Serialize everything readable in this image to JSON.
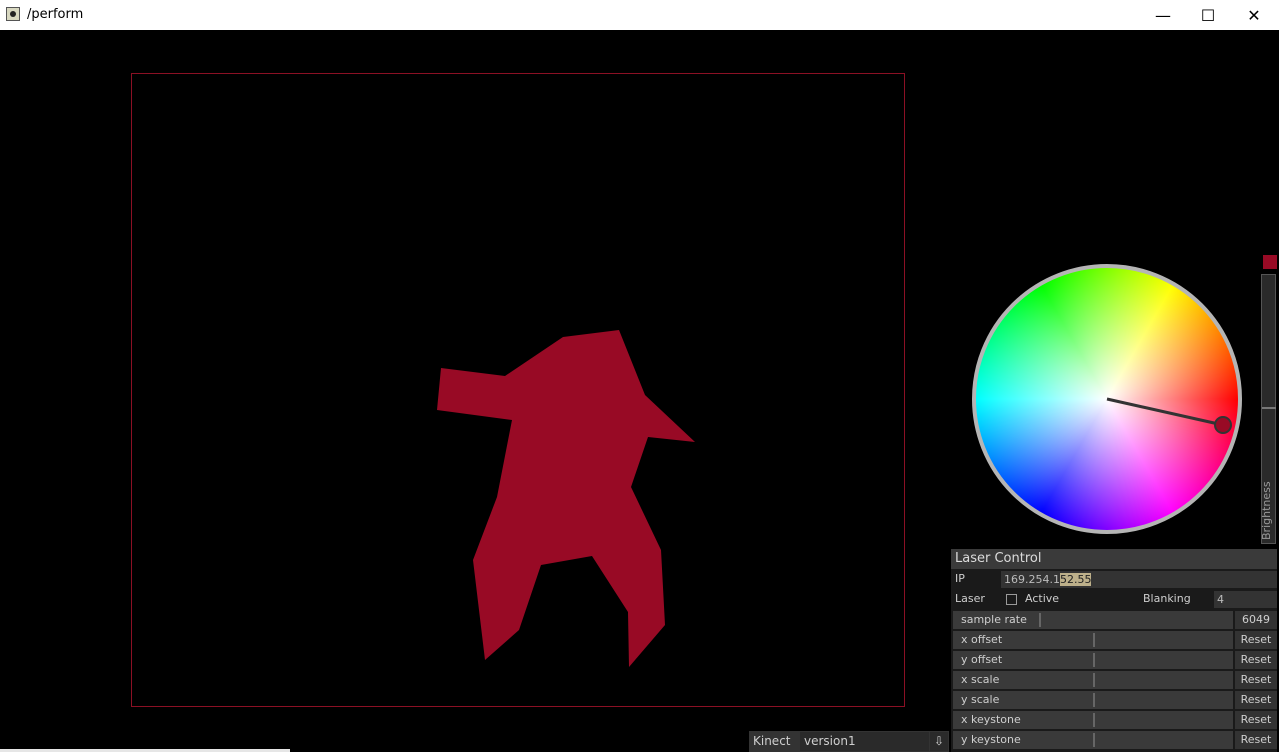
{
  "window": {
    "title": "/perform",
    "minimize_glyph": "—",
    "maximize_glyph": "☐",
    "close_glyph": "✕",
    "icon": "app-icon"
  },
  "colors": {
    "figure": "#980a25",
    "frame": "#8b1024",
    "background": "#000000"
  },
  "brightness": {
    "label": "Brightness"
  },
  "laser_control": {
    "title": "Laser Control",
    "ip_label": "IP",
    "ip_value_plain": "169.254.1",
    "ip_value_selected": "52.55",
    "laser_label": "Laser",
    "active_label": "Active",
    "blanking_label": "Blanking",
    "blanking_value": "4",
    "sample_rate_label": "sample rate",
    "sample_rate_value": "6049",
    "reset_label": "Reset",
    "sliders": [
      {
        "label": "x offset",
        "fill": 0.5
      },
      {
        "label": "y offset",
        "fill": 0.5
      },
      {
        "label": "x scale",
        "fill": 0.5
      },
      {
        "label": "y scale",
        "fill": 0.5
      },
      {
        "label": "x keystone",
        "fill": 0.5
      },
      {
        "label": "y keystone",
        "fill": 0.5
      }
    ]
  },
  "kinect": {
    "label": "Kinect",
    "selected": "version1",
    "arrow": "⇩"
  }
}
